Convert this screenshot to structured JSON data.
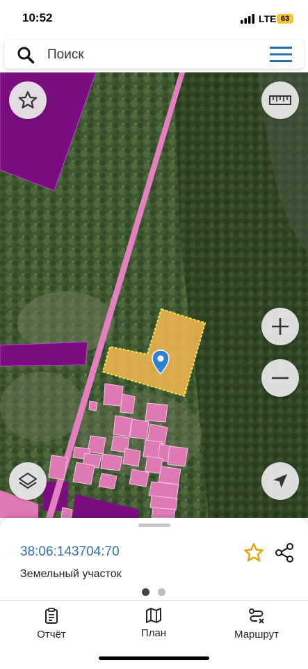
{
  "status_bar": {
    "time": "10:52",
    "network": "LTE",
    "battery": "63"
  },
  "search": {
    "placeholder": "Поиск"
  },
  "map": {
    "buttons": [
      "favorites",
      "ruler",
      "zoom-in",
      "zoom-out",
      "layers",
      "my-location"
    ],
    "colors": {
      "parcel_selected": "#f0b552",
      "parcel_pink": "#df79b4",
      "zone_purple": "#7a0e80",
      "road_pink": "#e57fbf"
    }
  },
  "sheet": {
    "cadastral_number": "38:06:143704:70",
    "parcel_type": "Земельный участок"
  },
  "tabs": [
    {
      "label": "Отчёт",
      "icon": "report-icon"
    },
    {
      "label": "План",
      "icon": "map-icon"
    },
    {
      "label": "Маршрут",
      "icon": "route-icon"
    }
  ],
  "colors": {
    "link": "#2e6eb0",
    "accent_star": "#e2a400",
    "menu": "#2b6cb0"
  }
}
